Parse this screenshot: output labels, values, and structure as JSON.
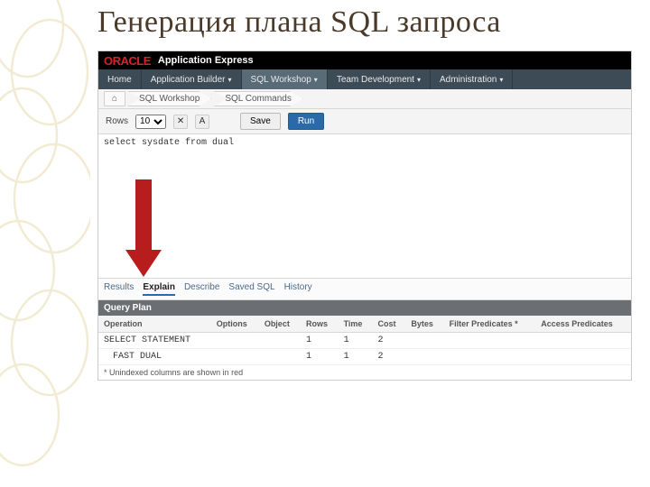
{
  "slide": {
    "title": "Генерация плана SQL запроса"
  },
  "brand": {
    "logo": "ORACLE",
    "product": "Application Express"
  },
  "nav": {
    "items": [
      {
        "label": "Home",
        "dd": false
      },
      {
        "label": "Application Builder",
        "dd": true
      },
      {
        "label": "SQL Workshop",
        "dd": true,
        "active": true
      },
      {
        "label": "Team Development",
        "dd": true
      },
      {
        "label": "Administration",
        "dd": true
      }
    ]
  },
  "crumbs": {
    "home_icon": "⌂",
    "a": "SQL Workshop",
    "b": "SQL Commands"
  },
  "toolbar": {
    "rows_label": "Rows",
    "rows_value": "10",
    "save_label": "Save",
    "run_label": "Run"
  },
  "sql": {
    "text": "select sysdate from dual"
  },
  "tabs": {
    "results": "Results",
    "explain": "Explain",
    "describe": "Describe",
    "saved": "Saved SQL",
    "history": "History"
  },
  "panel": {
    "title": "Query Plan"
  },
  "plan": {
    "headers": {
      "operation": "Operation",
      "options": "Options",
      "object": "Object",
      "rows": "Rows",
      "time": "Time",
      "cost": "Cost",
      "bytes": "Bytes",
      "filter": "Filter Predicates *",
      "access": "Access Predicates"
    },
    "rows": [
      {
        "operation": "SELECT STATEMENT",
        "options": "",
        "object": "",
        "rows": "1",
        "time": "1",
        "cost": "2",
        "bytes": "",
        "filter": "",
        "access": ""
      },
      {
        "operation": "FAST DUAL",
        "options": "",
        "object": "",
        "rows": "1",
        "time": "1",
        "cost": "2",
        "bytes": "",
        "filter": "",
        "access": ""
      }
    ],
    "footnote": "* Unindexed columns are shown in red"
  }
}
